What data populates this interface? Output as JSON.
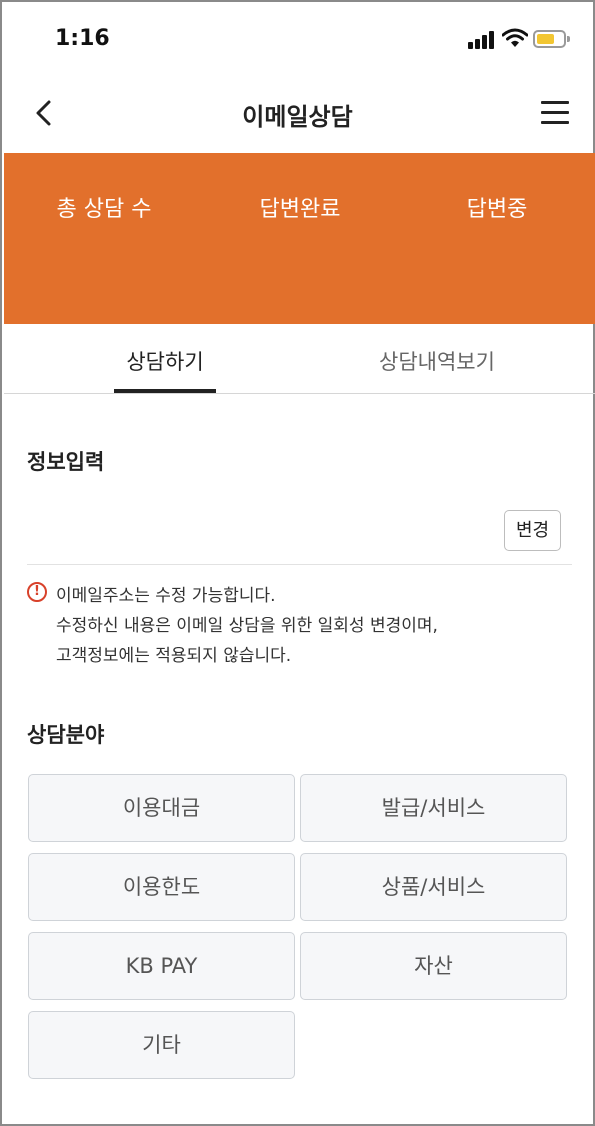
{
  "status_bar": {
    "time": "1:16"
  },
  "header": {
    "title": "이메일상담"
  },
  "stats": {
    "total_label": "총 상담 수",
    "answered_label": "답변완료",
    "pending_label": "답변중"
  },
  "tabs": [
    {
      "label": "상담하기",
      "active": true
    },
    {
      "label": "상담내역보기",
      "active": false
    }
  ],
  "info_section": {
    "title": "정보입력",
    "change_label": "변경"
  },
  "notice": {
    "icon": "!",
    "lines": [
      "이메일주소는 수정 가능합니다.",
      "수정하신 내용은 이메일 상담을 위한 일회성 변경이며,",
      "고객정보에는 적용되지 않습니다."
    ]
  },
  "category_section": {
    "title": "상담분야",
    "options": [
      "이용대금",
      "발급/서비스",
      "이용한도",
      "상품/서비스",
      "KB PAY",
      "자산",
      "기타"
    ]
  },
  "colors": {
    "banner": "#e2702c",
    "warning": "#d8412a",
    "battery": "#f2c632"
  }
}
